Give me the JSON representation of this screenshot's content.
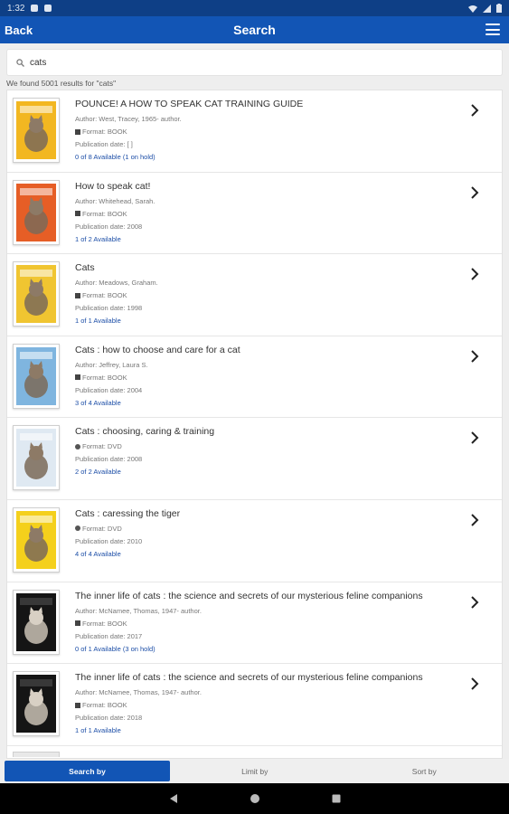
{
  "status_bar": {
    "time": "1:32"
  },
  "app_bar": {
    "back_label": "Back",
    "title": "Search"
  },
  "search": {
    "value": "cats",
    "placeholder": "Search"
  },
  "results_summary": "We found 5001 results for \"cats\"",
  "results": [
    {
      "title": "POUNCE! A HOW TO SPEAK CAT TRAINING GUIDE",
      "author": "Author: West, Tracey, 1965- author.",
      "format": "Format: BOOK",
      "format_icon": "book-icon",
      "date": "Publication date: [ ]",
      "availability": "0 of 8 Available (1 on hold)",
      "cover_color": "#f2b721"
    },
    {
      "title": "How to speak cat!",
      "author": "Author: Whitehead, Sarah.",
      "format": "Format: BOOK",
      "format_icon": "book-icon",
      "date": "Publication date: 2008",
      "availability": "1 of 2 Available",
      "cover_color": "#e65e26"
    },
    {
      "title": "Cats",
      "author": "Author: Meadows, Graham.",
      "format": "Format: BOOK",
      "format_icon": "book-icon",
      "date": "Publication date: 1998",
      "availability": "1 of 1 Available",
      "cover_color": "#f0c531"
    },
    {
      "title": "Cats : how to choose and care for a cat",
      "author": "Author: Jeffrey, Laura S.",
      "format": "Format: BOOK",
      "format_icon": "book-icon",
      "date": "Publication date: 2004",
      "availability": "3 of 4 Available",
      "cover_color": "#7fb5df"
    },
    {
      "title": "Cats : choosing, caring & training",
      "author": "",
      "format": "Format: DVD",
      "format_icon": "dvd-icon",
      "date": "Publication date: 2008",
      "availability": "2 of 2 Available",
      "cover_color": "#dfe9f2"
    },
    {
      "title": "Cats : caressing the tiger",
      "author": "",
      "format": "Format: DVD",
      "format_icon": "dvd-icon",
      "date": "Publication date: 2010",
      "availability": "4 of 4 Available",
      "cover_color": "#f4d01c"
    },
    {
      "title": "The inner life of cats : the science and secrets of our mysterious feline companions",
      "author": "Author: McNamee, Thomas, 1947- author.",
      "format": "Format: BOOK",
      "format_icon": "book-icon",
      "date": "Publication date: 2017",
      "availability": "0 of 1 Available (3 on hold)",
      "cover_color": "#151515"
    },
    {
      "title": "The inner life of cats : the science and secrets of our mysterious feline companions",
      "author": "Author: McNamee, Thomas, 1947- author.",
      "format": "Format: BOOK",
      "format_icon": "book-icon",
      "date": "Publication date: 2018",
      "availability": "1 of 1 Available",
      "cover_color": "#151515"
    }
  ],
  "tabs": [
    {
      "label": "Search by",
      "active": true
    },
    {
      "label": "Limit by",
      "active": false
    },
    {
      "label": "Sort by",
      "active": false
    }
  ],
  "colors": {
    "accent": "#1255b5",
    "status_bar": "#0e3f86",
    "availability": "#1c4ea7"
  }
}
